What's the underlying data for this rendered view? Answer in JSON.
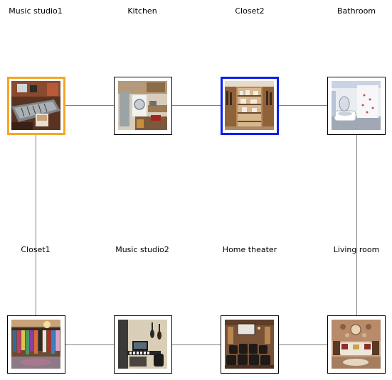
{
  "rooms": [
    {
      "id": "music-studio1",
      "label": "Music studio1",
      "state": "visited",
      "thumbnail": "mixing-console-photo"
    },
    {
      "id": "kitchen",
      "label": "Kitchen",
      "state": "normal",
      "thumbnail": "kitchen-photo"
    },
    {
      "id": "closet2",
      "label": "Closet2",
      "state": "target",
      "thumbnail": "walk-in-closet-shelves-photo"
    },
    {
      "id": "bathroom",
      "label": "Bathroom",
      "state": "normal",
      "thumbnail": "bathroom-photo"
    },
    {
      "id": "closet1",
      "label": "Closet1",
      "state": "normal",
      "thumbnail": "clothing-closet-photo"
    },
    {
      "id": "music-studio2",
      "label": "Music studio2",
      "state": "normal",
      "thumbnail": "home-studio-guitars-photo"
    },
    {
      "id": "home-theater",
      "label": "Home theater",
      "state": "normal",
      "thumbnail": "theater-seating-photo"
    },
    {
      "id": "living-room",
      "label": "Living room",
      "state": "normal",
      "thumbnail": "living-room-sofa-photo"
    }
  ],
  "connections": [
    [
      "music-studio1",
      "kitchen"
    ],
    [
      "kitchen",
      "closet2"
    ],
    [
      "closet2",
      "bathroom"
    ],
    [
      "music-studio1",
      "closet1"
    ],
    [
      "bathroom",
      "living-room"
    ],
    [
      "closet1",
      "music-studio2"
    ],
    [
      "music-studio2",
      "home-theater"
    ],
    [
      "home-theater",
      "living-room"
    ]
  ],
  "colors": {
    "visited_border": "#f5a623",
    "target_border": "#0a1ef0",
    "edge": "#808080"
  }
}
